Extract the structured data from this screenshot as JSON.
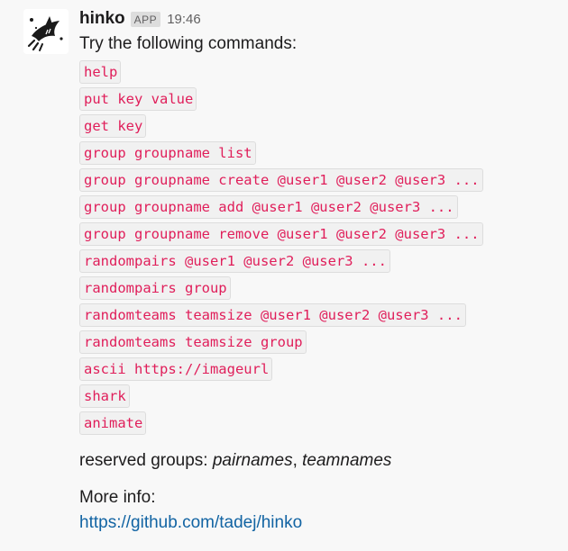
{
  "message": {
    "sender": "hinko",
    "badge": "APP",
    "time": "19:46",
    "intro": "Try the following commands:",
    "commands": [
      "help",
      "put key value",
      "get key",
      "group groupname list",
      "group groupname create @user1 @user2 @user3 ...",
      "group groupname add @user1 @user2 @user3 ...",
      "group groupname remove @user1 @user2 @user3 ...",
      "randompairs @user1 @user2 @user3 ...",
      "randompairs group",
      "randomteams teamsize @user1 @user2 @user3 ...",
      "randomteams teamsize group",
      "ascii https://imageurl",
      "shark",
      "animate"
    ],
    "reserved_prefix": "reserved groups: ",
    "reserved_group_1": "pairnames",
    "reserved_sep": ", ",
    "reserved_group_2": "teamnames",
    "more_info": "More info:",
    "link": "https://github.com/tadej/hinko"
  },
  "colors": {
    "code_text": "#e01e5a",
    "code_bg": "#f1f1f1",
    "link": "#1264a3",
    "background": "#f8f8f8"
  },
  "icons": {
    "avatar": "shark-logo-icon"
  }
}
